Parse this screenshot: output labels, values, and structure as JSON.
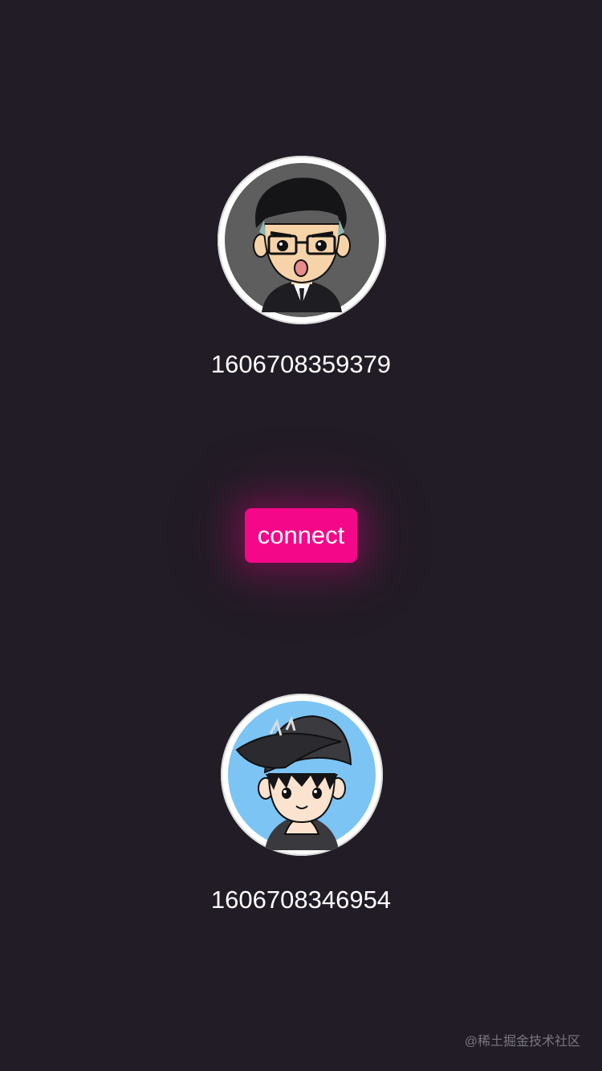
{
  "caller": {
    "id": "1606708359379",
    "avatar_icon": "boy-with-glasses-avatar",
    "avatar_bg": "#5e5e5e"
  },
  "action": {
    "connect_label": "connect",
    "accent_color": "#f5078a"
  },
  "callee": {
    "id": "1606708346954",
    "avatar_icon": "boy-with-cap-avatar",
    "avatar_bg": "#7cc4f4"
  },
  "watermark": "@稀土掘金技术社区",
  "colors": {
    "background": "#211c26",
    "text": "#ffffff"
  }
}
